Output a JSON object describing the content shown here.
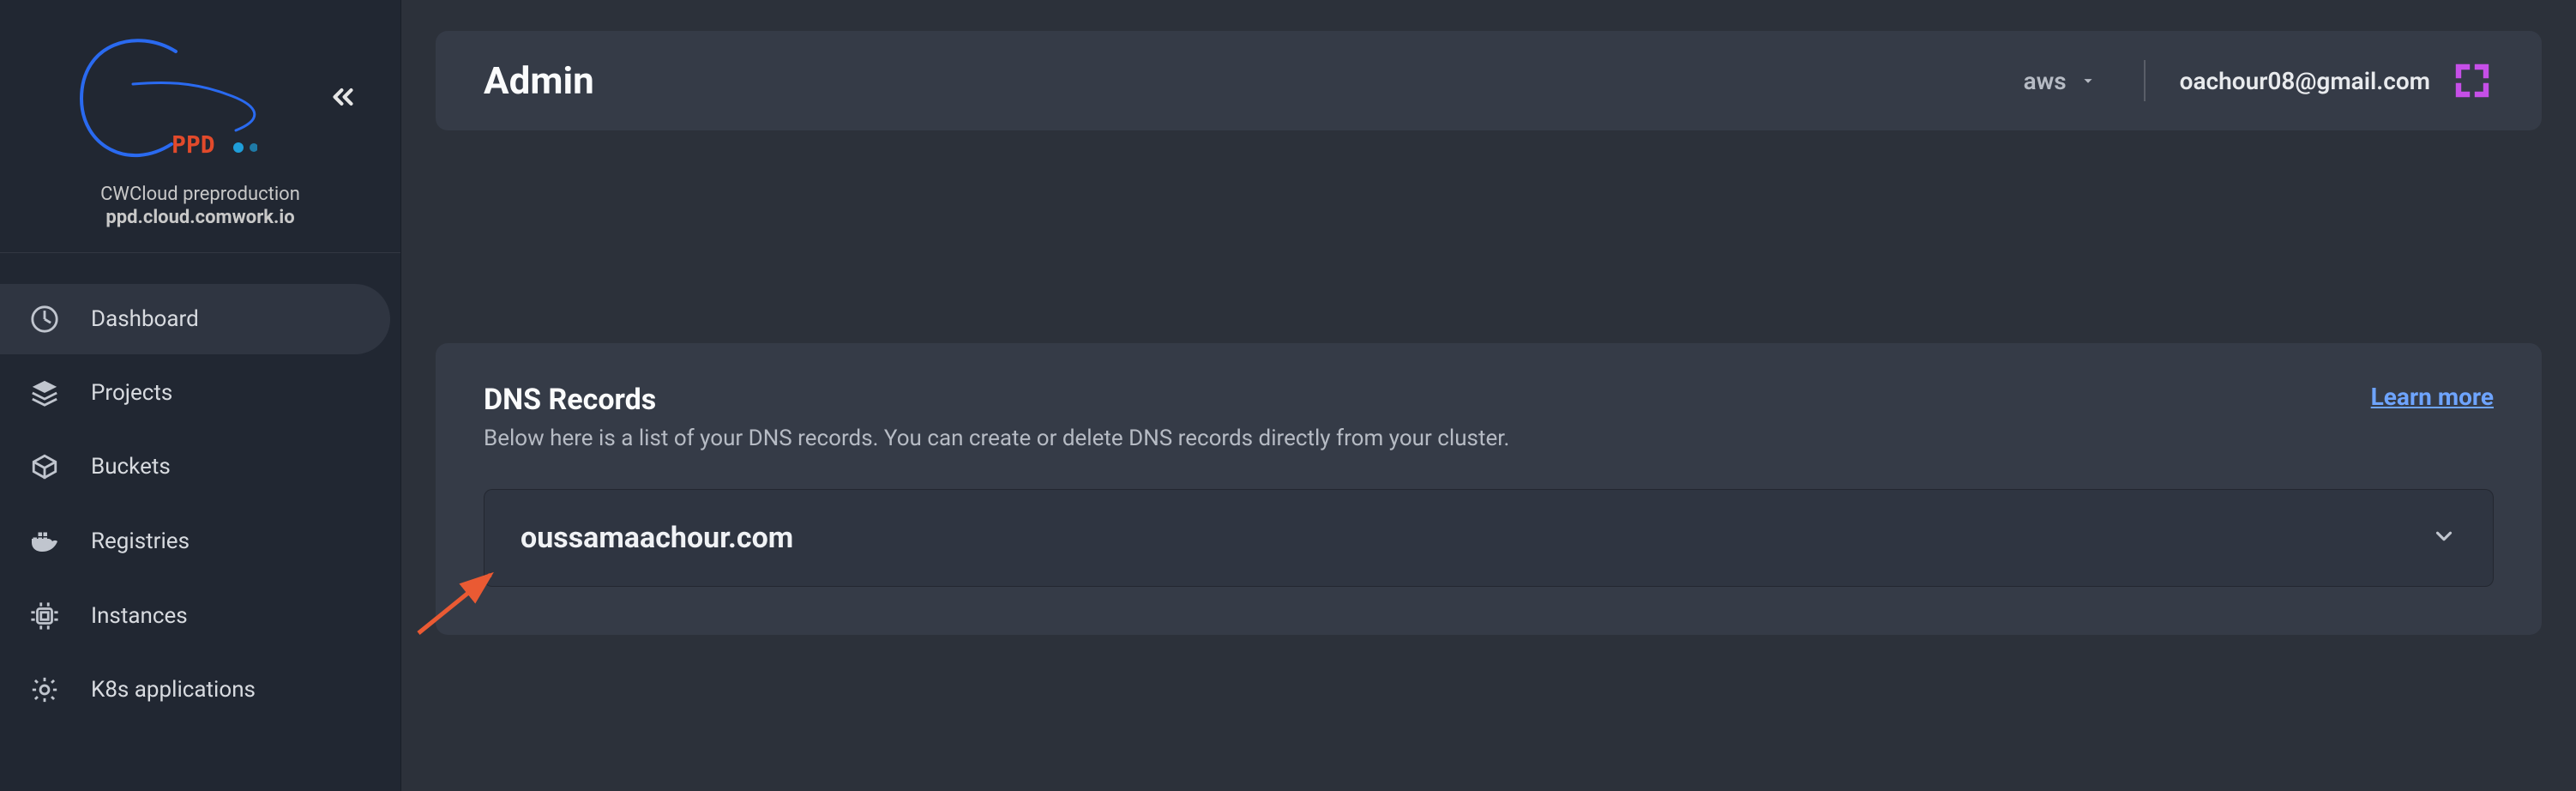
{
  "env": {
    "title": "CWCloud preproduction",
    "host": "ppd.cloud.comwork.io"
  },
  "nav": {
    "items": [
      {
        "label": "Dashboard",
        "icon": "dashboard-icon"
      },
      {
        "label": "Projects",
        "icon": "layers-icon"
      },
      {
        "label": "Buckets",
        "icon": "cube-icon"
      },
      {
        "label": "Registries",
        "icon": "docker-icon"
      },
      {
        "label": "Instances",
        "icon": "chip-icon"
      },
      {
        "label": "K8s applications",
        "icon": "gear-icon"
      }
    ]
  },
  "header": {
    "page_title": "Admin",
    "cloud_selected": "aws",
    "user_email": "oachour08@gmail.com"
  },
  "panel": {
    "title": "DNS Records",
    "subtitle": "Below here is a list of your DNS records. You can create or delete DNS records directly from your cluster.",
    "learn_more": "Learn more",
    "domains": [
      {
        "name": "oussamaachour.com"
      }
    ]
  },
  "colors": {
    "accent_link": "#6ea4ff",
    "qr_icon": "#c64fe8"
  }
}
